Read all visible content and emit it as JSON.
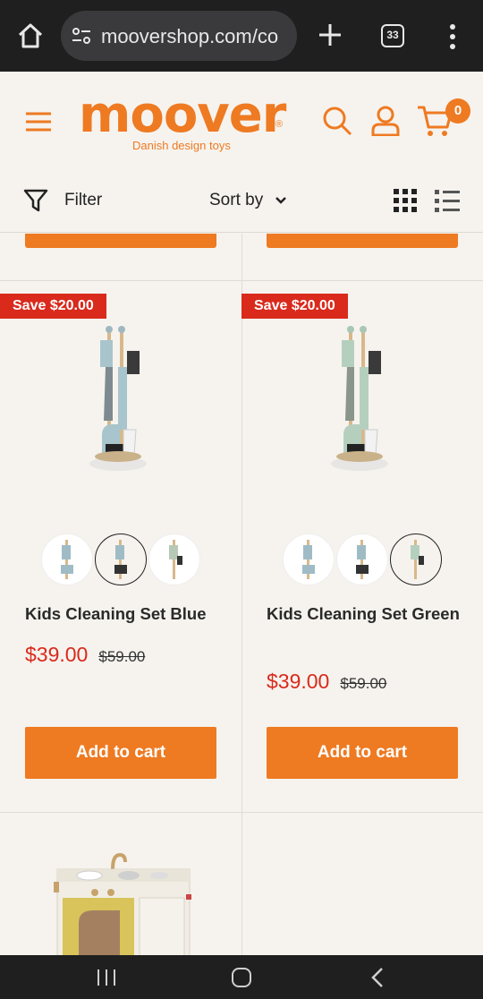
{
  "browser": {
    "url": "moovershop.com/co",
    "tab_count": "33"
  },
  "header": {
    "logo_text": "moover",
    "logo_tagline": "Danish design toys",
    "cart_count": "0",
    "brand_color": "#ee7a22"
  },
  "toolbar": {
    "filter_label": "Filter",
    "sort_label": "Sort by"
  },
  "products": [
    {
      "badge": "Save $20.00",
      "name": "Kids Cleaning Set Blue",
      "price": "$39.00",
      "compare_price": "$59.00",
      "add_label": "Add to cart",
      "selected_swatch": 2
    },
    {
      "badge": "Save $20.00",
      "name": "Kids Cleaning Set Green",
      "price": "$39.00",
      "compare_price": "$59.00",
      "add_label": "Add to cart",
      "selected_swatch": 3
    }
  ],
  "colors": {
    "sale_red": "#d92a1c",
    "accent_orange": "#ee7a22"
  }
}
